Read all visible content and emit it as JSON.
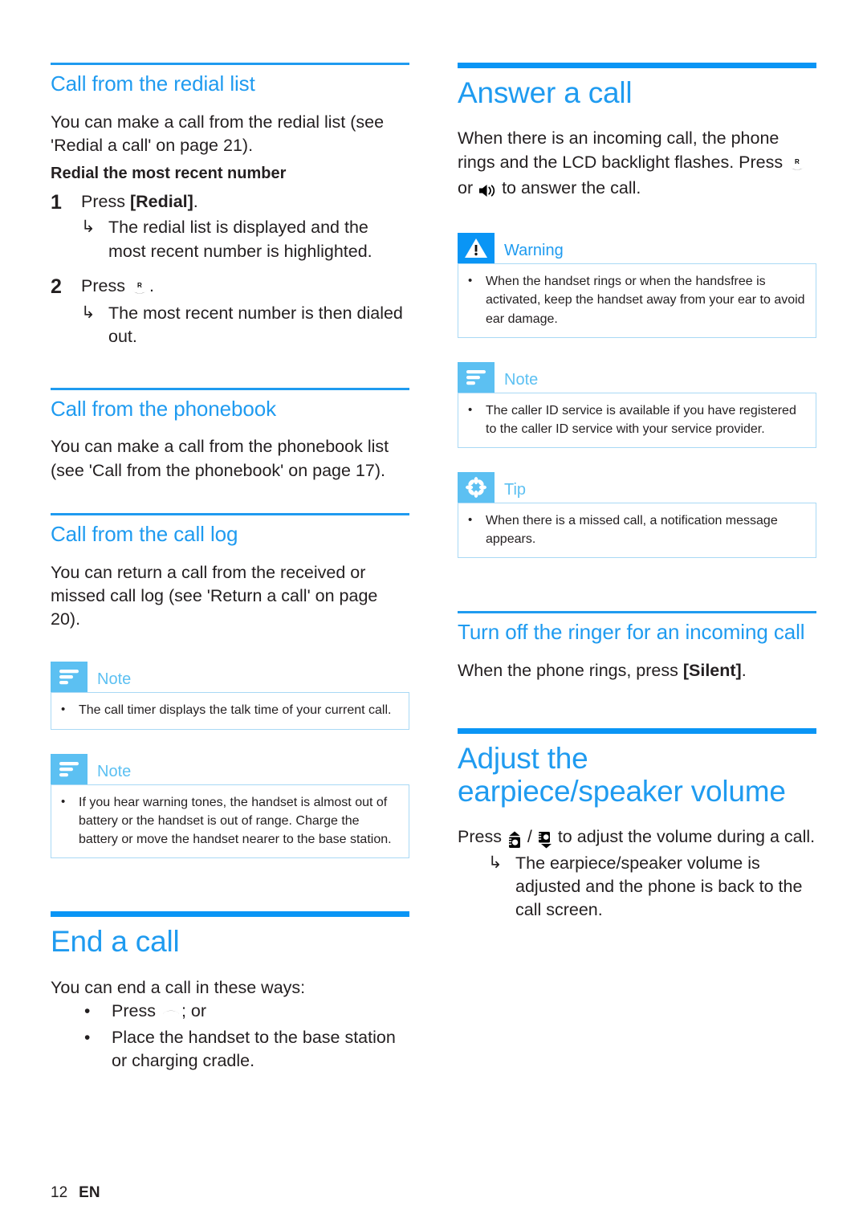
{
  "page": {
    "number": "12",
    "language": "EN"
  },
  "colors": {
    "heading_blue": "#1f9bf0",
    "rule_blue": "#0a95f5",
    "callout_icon_light": "#5cc0f2",
    "callout_border": "#a9d9f5",
    "body_text": "#231f20"
  },
  "left_column": {
    "section_redial": {
      "heading": "Call from the redial list",
      "intro_line1": "You can make a call from the redial list (see",
      "intro_line2": "'Redial a call' on page 21).",
      "subheading": "Redial the most recent number",
      "steps": [
        {
          "number": "1",
          "text_before": "Press ",
          "text_bold": "[Redial]",
          "text_after": ".",
          "result": "The redial list is displayed and the most recent number is highlighted."
        },
        {
          "number": "2",
          "text_before": "Press ",
          "icon": "call-key-icon",
          "text_after": ".",
          "result": "The most recent number is then dialed out."
        }
      ]
    },
    "section_phonebook": {
      "heading": "Call from the phonebook",
      "body": "You can make a call from the phonebook list (see 'Call from the phonebook' on page 17)."
    },
    "section_call_log": {
      "heading": "Call from the call log",
      "body": "You can return a call from the received or missed call log (see 'Return a call' on page 20).",
      "note1": {
        "label": "Note",
        "icon": "note-icon",
        "items": [
          "The call timer displays the talk time of your current call."
        ]
      },
      "note2": {
        "label": "Note",
        "icon": "note-icon",
        "items": [
          "If you hear warning tones, the handset is almost out of battery or the handset is out of range. Charge the battery or move the handset nearer to the base station."
        ]
      }
    },
    "section_end_call": {
      "heading": "End a call",
      "intro": "You can end a call in these ways:",
      "bullets": [
        {
          "text_before": "Press ",
          "icon": "hangup-key-icon",
          "text_after": "; or"
        },
        {
          "text_before": "Place the handset to the base station or charging cradle.",
          "icon": "",
          "text_after": ""
        }
      ]
    }
  },
  "right_column": {
    "section_answer": {
      "heading": "Answer a call",
      "body_part1": "When there is an incoming call, the phone rings and the LCD backlight flashes. Press ",
      "icon1": "call-key-icon",
      "body_part2": " or ",
      "icon2": "speaker-icon",
      "body_part3": " to answer the call.",
      "warning": {
        "label": "Warning",
        "icon": "warning-triangle-icon",
        "items": [
          "When the handset rings or when the handsfree is activated, keep the handset away from your ear to avoid ear damage."
        ]
      },
      "note": {
        "label": "Note",
        "icon": "note-icon",
        "items": [
          "The caller ID service is available if you have registered to the caller ID service with your service provider."
        ]
      },
      "tip": {
        "label": "Tip",
        "icon": "tip-asterisk-icon",
        "items": [
          "When there is a missed call, a notification message appears."
        ]
      }
    },
    "section_ringer_off": {
      "heading": "Turn off the ringer for an incoming call",
      "body_before": "When the phone rings, press ",
      "body_bold": "[Silent]",
      "body_after": "."
    },
    "section_volume": {
      "heading": "Adjust the earpiece/speaker volume",
      "body_before": "Press ",
      "icon_up": "volume-up-icon",
      "body_sep": " / ",
      "icon_down": "volume-down-icon",
      "body_after": " to adjust the volume during a call.",
      "result": "The earpiece/speaker volume is adjusted and the phone is back to the call screen."
    }
  }
}
